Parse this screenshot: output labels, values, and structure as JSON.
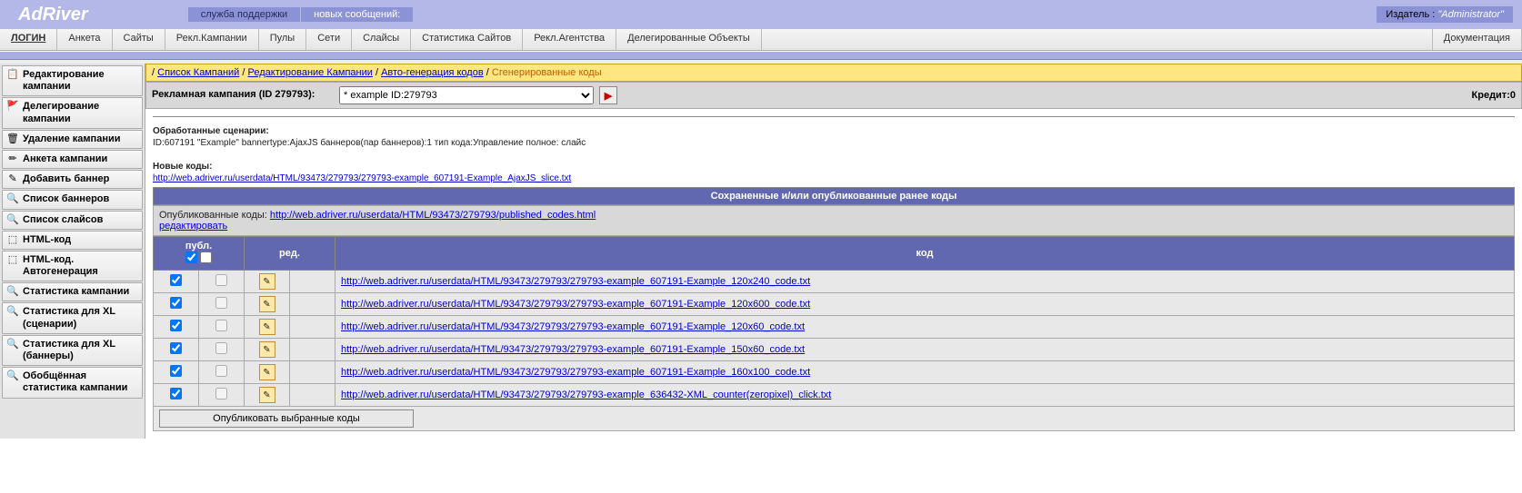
{
  "header": {
    "logo": "AdRiver",
    "support_label": "служба поддержки",
    "new_messages_label": "новых сообщений:",
    "publisher_label": "Издатель",
    "publisher_sep": " : ",
    "publisher_user": "\"Administrator\""
  },
  "tabs": {
    "items": [
      "ЛОГИН",
      "Анкета",
      "Сайты",
      "Рекл.Кампании",
      "Пулы",
      "Сети",
      "Слайсы",
      "Статистика Сайтов",
      "Рекл.Агентства",
      "Делегированные Объекты"
    ],
    "doc": "Документация"
  },
  "sidebar": {
    "items": [
      {
        "icon": "📋",
        "label": "Редактирование кампании"
      },
      {
        "icon": "🚩",
        "label": "Делегирование кампании"
      },
      {
        "icon": "🗑",
        "label": "Удаление кампании"
      },
      {
        "icon": "✏",
        "label": "Анкета кампании"
      },
      {
        "icon": "✎",
        "label": "Добавить баннер"
      },
      {
        "icon": "🔍",
        "label": "Список баннеров"
      },
      {
        "icon": "🔍",
        "label": "Список слайсов"
      },
      {
        "icon": "⬚",
        "label": "HTML-код"
      },
      {
        "icon": "⬚",
        "label": "HTML-код. Автогенерация"
      },
      {
        "icon": "🔍",
        "label": "Статистика кампании"
      },
      {
        "icon": "🔍",
        "label": "Статистика для XL (сценарии)"
      },
      {
        "icon": "🔍",
        "label": "Статистика для XL (баннеры)"
      },
      {
        "icon": "🔍",
        "label": "Обобщённая статистика кампании"
      }
    ]
  },
  "breadcrumb": {
    "sep": " / ",
    "items": [
      "Список Кампаний",
      "Редактирование Кампании",
      "Авто-генерация кодов"
    ],
    "current": "Сгенерированные коды"
  },
  "campaign": {
    "label": "Рекламная кампания (ID 279793):",
    "select_value": "* example ID:279793",
    "credit_label": "Кредит:",
    "credit_value": "0"
  },
  "processed": {
    "title": "Обработанные сценарии:",
    "line": "ID:607191 \"Example\" bannertype:AjaxJS баннеров(пар баннеров):1 тип кода:Управление полное: слайс"
  },
  "newcodes": {
    "title": "Новые коды:",
    "link": "http://web.adriver.ru/userdata/HTML/93473/279793/279793-example_607191-Example_AjaxJS_slice.txt"
  },
  "saved": {
    "header": "Сохраненные и/или опубликованные ранее коды",
    "published_label": "Опубликованные коды: ",
    "published_link": "http://web.adriver.ru/userdata/HTML/93473/279793/published_codes.html",
    "edit_link": "редактировать"
  },
  "table": {
    "col_pub": "публ.",
    "col_edit": "ред.",
    "col_code": "код",
    "rows": [
      {
        "link": "http://web.adriver.ru/userdata/HTML/93473/279793/279793-example_607191-Example_120x240_code.txt"
      },
      {
        "link": "http://web.adriver.ru/userdata/HTML/93473/279793/279793-example_607191-Example_120x600_code.txt"
      },
      {
        "link": "http://web.adriver.ru/userdata/HTML/93473/279793/279793-example_607191-Example_120x60_code.txt"
      },
      {
        "link": "http://web.adriver.ru/userdata/HTML/93473/279793/279793-example_607191-Example_150x60_code.txt"
      },
      {
        "link": "http://web.adriver.ru/userdata/HTML/93473/279793/279793-example_607191-Example_160x100_code.txt"
      },
      {
        "link": "http://web.adriver.ru/userdata/HTML/93473/279793/279793-example_636432-XML_counter(zeropixel)_click.txt"
      }
    ],
    "publish_button": "Опубликовать выбранные коды"
  },
  "icons": {
    "go": "▶",
    "pencil": "✎"
  }
}
